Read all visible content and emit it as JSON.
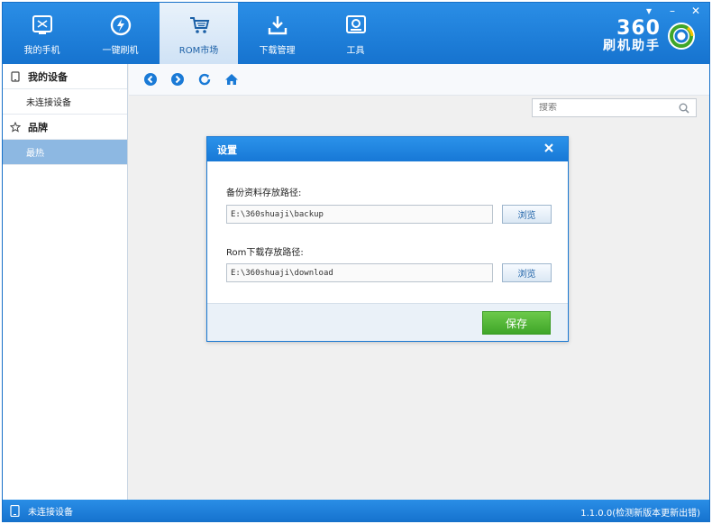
{
  "nav": {
    "items": [
      {
        "label": "我的手机",
        "icon": "phone-icon"
      },
      {
        "label": "一键刷机",
        "icon": "flash-icon"
      },
      {
        "label": "ROM市场",
        "icon": "cart-icon"
      },
      {
        "label": "下载管理",
        "icon": "download-icon"
      },
      {
        "label": "工具",
        "icon": "toolbox-icon"
      }
    ],
    "active_index": 2
  },
  "window_controls": {
    "menu": "▾",
    "minimize": "–",
    "close": "✕"
  },
  "logo": {
    "number": "360",
    "text": "刷机助手",
    "icon": "360-logo-icon"
  },
  "sidebar": {
    "section_device": "我的设备",
    "device_item": "未连接设备",
    "section_brand": "品牌",
    "brand_item": "最热"
  },
  "toolbar": {
    "icons": [
      "back-icon",
      "forward-icon",
      "refresh-icon",
      "home-icon"
    ]
  },
  "search": {
    "placeholder": "搜索"
  },
  "dialog": {
    "title": "设置",
    "backup_label": "备份资料存放路径:",
    "backup_path": "E:\\360shuaji\\backup",
    "rom_label": "Rom下载存放路径:",
    "rom_path": "E:\\360shuaji\\download",
    "browse_label": "浏览",
    "save_label": "保存"
  },
  "status": {
    "device": "未连接设备",
    "version": "1.1.0.0(检测新版本更新出错)"
  },
  "colors": {
    "primary_blue": "#1a7ad6",
    "save_green": "#4cb233",
    "sidebar_selected": "#8db8e2"
  }
}
